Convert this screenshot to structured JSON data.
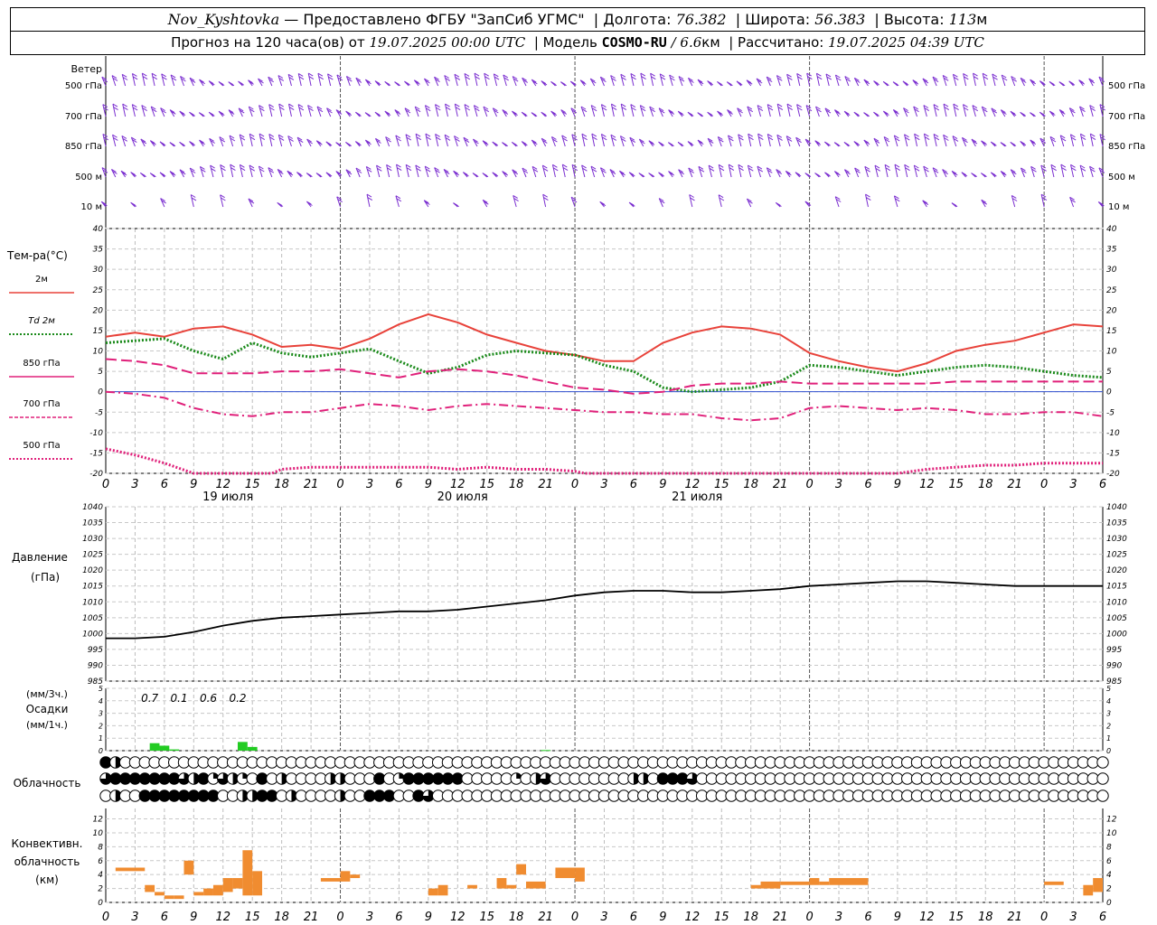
{
  "header": {
    "station": "Nov_Kyshtovka",
    "provided_by": "— Предоставлено ФГБУ \"ЗапСиб УГМС\"",
    "lon_label": "Долгота:",
    "lon_value": "76.382",
    "lat_label": "Широта:",
    "lat_value": "56.383",
    "alt_label": "Высота:",
    "alt_value": "113",
    "alt_unit": "м",
    "forecast_label": "Прогноз на 120 часа(ов) от",
    "forecast_start": "19.07.2025 00:00 UTC",
    "model_label": "Модель",
    "model_name": "COSMO-RU",
    "model_res": "/ 6.6",
    "model_res_unit": "км",
    "calc_label": "Рассчитано:",
    "calc_time": "19.07.2025 04:39 UTC"
  },
  "wind_panel": {
    "title": "Ветер",
    "levels": [
      "500 гПа",
      "700 гПа",
      "850 гПа",
      "500 м",
      "10 м"
    ],
    "color": "#7b2fd0"
  },
  "temp_panel": {
    "title": "Тем-ра(°С)",
    "series_labels": [
      "2м",
      "Td  2м",
      "850 гПа",
      "700 гПа",
      "500 гПа"
    ]
  },
  "pressure_panel": {
    "title": "Давление",
    "unit": "(гПа)"
  },
  "precip_panel": {
    "unit_top": "(мм/3ч.)",
    "title": "Осадки",
    "unit_bottom": "(мм/1ч.)",
    "totals": [
      {
        "hour": 4.5,
        "text": "0.7"
      },
      {
        "hour": 7.5,
        "text": "0.1"
      },
      {
        "hour": 10.5,
        "text": "0.6"
      },
      {
        "hour": 13.5,
        "text": "0.2"
      }
    ]
  },
  "cloud_panel": {
    "title": "Облачность"
  },
  "conv_panel": {
    "title_lines": [
      "Конвективн.",
      "облачность",
      "(км)"
    ]
  },
  "axis": {
    "hour_labels": [
      "0",
      "3",
      "6",
      "9",
      "12",
      "15",
      "18",
      "21"
    ],
    "day_labels": [
      "19 июля",
      "20 июля",
      "21 июля"
    ]
  },
  "chart_data": [
    {
      "type": "line",
      "title": "Тем-ра(°С)",
      "x_unit": "hours since 19.07.2025 00 UTC",
      "ylim": [
        -20,
        40
      ],
      "yticks": [
        -20,
        -15,
        -10,
        -5,
        0,
        5,
        10,
        15,
        20,
        25,
        30,
        35,
        40
      ],
      "series": [
        {
          "name": "2м",
          "color": "#e8423a",
          "style": "solid",
          "x": [
            0,
            3,
            6,
            9,
            12,
            15,
            18,
            21,
            24,
            27,
            30,
            33,
            36,
            39,
            42,
            45,
            48,
            51,
            54,
            57,
            60,
            63,
            66,
            69,
            72,
            75,
            78,
            81,
            84,
            87,
            90,
            93,
            96,
            99,
            102
          ],
          "y": [
            13.5,
            14.5,
            13.5,
            15.5,
            16,
            14,
            11,
            11.5,
            10.5,
            13,
            16.5,
            19,
            17,
            14,
            12,
            10,
            9,
            7.5,
            7.5,
            12,
            14.5,
            16,
            15.5,
            14,
            9.5,
            7.5,
            6,
            5,
            7,
            10,
            11.5,
            12.5,
            14.5,
            16.5,
            16
          ]
        },
        {
          "name": "Td  2м",
          "color": "#1a8a1a",
          "style": "dotted",
          "x": [
            0,
            3,
            6,
            9,
            12,
            15,
            18,
            21,
            24,
            27,
            30,
            33,
            36,
            39,
            42,
            45,
            48,
            51,
            54,
            57,
            60,
            63,
            66,
            69,
            72,
            75,
            78,
            81,
            84,
            87,
            90,
            93,
            96,
            99,
            102
          ],
          "y": [
            12,
            12.5,
            13,
            10,
            8,
            12,
            9.5,
            8.5,
            9.5,
            10.5,
            7.5,
            4.5,
            6,
            9,
            10,
            9.5,
            9,
            6.5,
            5,
            1,
            0,
            0.5,
            1,
            2.5,
            6.5,
            6,
            5,
            4,
            5,
            6,
            6.5,
            6,
            5,
            4,
            3.5
          ]
        },
        {
          "name": "850 гПа",
          "color": "#e0207a",
          "style": "long-dash",
          "x": [
            0,
            3,
            6,
            9,
            12,
            15,
            18,
            21,
            24,
            27,
            30,
            33,
            36,
            39,
            42,
            45,
            48,
            51,
            54,
            57,
            60,
            63,
            66,
            69,
            72,
            75,
            78,
            81,
            84,
            87,
            90,
            93,
            96,
            99,
            102
          ],
          "y": [
            8,
            7.5,
            6.5,
            4.5,
            4.5,
            4.5,
            5,
            5,
            5.5,
            4.5,
            3.5,
            5,
            5.5,
            5,
            4,
            2.5,
            1,
            0.5,
            -0.5,
            0,
            1.5,
            2,
            2,
            2.5,
            2,
            2,
            2,
            2,
            2,
            2.5,
            2.5,
            2.5,
            2.5,
            2.5,
            2.5
          ]
        },
        {
          "name": "700 гПа",
          "color": "#e0207a",
          "style": "dash-dot",
          "x": [
            0,
            3,
            6,
            9,
            12,
            15,
            18,
            21,
            24,
            27,
            30,
            33,
            36,
            39,
            42,
            45,
            48,
            51,
            54,
            57,
            60,
            63,
            66,
            69,
            72,
            75,
            78,
            81,
            84,
            87,
            90,
            93,
            96,
            99,
            102
          ],
          "y": [
            0,
            -0.5,
            -1.5,
            -4,
            -5.5,
            -6,
            -5,
            -5,
            -4,
            -3,
            -3.5,
            -4.5,
            -3.5,
            -3,
            -3.5,
            -4,
            -4.5,
            -5,
            -5,
            -5.5,
            -5.5,
            -6.5,
            -7,
            -6.5,
            -4,
            -3.5,
            -4,
            -4.5,
            -4,
            -4.5,
            -5.5,
            -5.5,
            -5,
            -5,
            -6
          ]
        },
        {
          "name": "500 гПа",
          "color": "#e0207a",
          "style": "dotted",
          "x": [
            0,
            3,
            6,
            9,
            10,
            11,
            12,
            13,
            14,
            15,
            16,
            17,
            18,
            21,
            24,
            27,
            30,
            33,
            36,
            39,
            42,
            45,
            48,
            49,
            50,
            51,
            80,
            81,
            84,
            87,
            90,
            93,
            96,
            99,
            102
          ],
          "y": [
            -14,
            -15.5,
            -17.5,
            -20,
            -21,
            -22,
            -23,
            -23,
            -22.5,
            -22,
            -21,
            -20,
            -19,
            -18.5,
            -18.5,
            -18.5,
            -18.5,
            -18.5,
            -19,
            -18.5,
            -19,
            -19,
            -19.5,
            -20,
            -21,
            -22,
            -21,
            -20,
            -19,
            -18.5,
            -18,
            -18,
            -17.5,
            -17.5,
            -17.5
          ]
        }
      ]
    },
    {
      "type": "line",
      "title": "Давление",
      "ylabel": "(гПа)",
      "x_unit": "hours since 19.07.2025 00 UTC",
      "ylim": [
        985,
        1040
      ],
      "yticks": [
        985,
        990,
        995,
        1000,
        1005,
        1010,
        1015,
        1020,
        1025,
        1030,
        1035,
        1040
      ],
      "series": [
        {
          "name": "",
          "color": "#000000",
          "x": [
            0,
            3,
            6,
            9,
            12,
            15,
            18,
            21,
            24,
            27,
            30,
            33,
            36,
            39,
            42,
            45,
            48,
            51,
            54,
            57,
            60,
            63,
            66,
            69,
            72,
            75,
            78,
            81,
            84,
            87,
            90,
            93,
            96,
            99,
            102
          ],
          "y": [
            998.5,
            998.5,
            999,
            1000.5,
            1002.5,
            1004,
            1005,
            1005.5,
            1006,
            1006.5,
            1007,
            1007,
            1007.5,
            1008.5,
            1009.5,
            1010.5,
            1012,
            1013,
            1013.5,
            1013.5,
            1013,
            1013,
            1013.5,
            1014,
            1015,
            1015.5,
            1016,
            1016.5,
            1016.5,
            1016,
            1015.5,
            1015,
            1015,
            1015,
            1015
          ]
        }
      ]
    },
    {
      "type": "bar",
      "title": "Осадки",
      "x_unit": "hours since 19.07.2025 00 UTC",
      "ylim": [
        0,
        5
      ],
      "yticks": [
        0,
        1,
        2,
        3,
        4,
        5
      ],
      "bars": [
        {
          "x": 5,
          "value": 0.6,
          "color": "#22cc22"
        },
        {
          "x": 6,
          "value": 0.4,
          "color": "#22cc22"
        },
        {
          "x": 7,
          "value": 0.1,
          "color": "#22cc22"
        },
        {
          "x": 14,
          "value": 0.7,
          "color": "#22cc22"
        },
        {
          "x": 15,
          "value": 0.3,
          "color": "#22cc22"
        },
        {
          "x": 45,
          "value": 0.05,
          "color": "#22cc22"
        }
      ]
    },
    {
      "type": "table",
      "title": "Облачность",
      "encoding": "cloud cover in octas per hour: 0 empty ... 8 full",
      "rows": [
        [
          8,
          4,
          0,
          0,
          0,
          0,
          0,
          0,
          0,
          0,
          0,
          0,
          0,
          0,
          0,
          0,
          0,
          0,
          0,
          0,
          0,
          0,
          0,
          0,
          0,
          0,
          0,
          0,
          0,
          0,
          0,
          0,
          0,
          0,
          0,
          0,
          0,
          0,
          0,
          0,
          0,
          0,
          0,
          0,
          0,
          0,
          0,
          0,
          0,
          0,
          0,
          0,
          0,
          0,
          0,
          0,
          0,
          0,
          0,
          0,
          0,
          0,
          0,
          0,
          0,
          0,
          0,
          0,
          0,
          0,
          0,
          0,
          0,
          0,
          0,
          0,
          0,
          0,
          0,
          0,
          0,
          0,
          0,
          0,
          0,
          0,
          0,
          0,
          0,
          0,
          0,
          0,
          0,
          0,
          0,
          0,
          0,
          0,
          0,
          0,
          0,
          0,
          0
        ],
        [
          6,
          8,
          8,
          8,
          8,
          8,
          8,
          8,
          6,
          4,
          8,
          2,
          6,
          4,
          2,
          0,
          8,
          0,
          4,
          0,
          0,
          0,
          0,
          4,
          4,
          0,
          0,
          0,
          8,
          0,
          2,
          8,
          8,
          8,
          8,
          8,
          8,
          0,
          0,
          0,
          0,
          0,
          2,
          0,
          4,
          6,
          0,
          0,
          0,
          0,
          0,
          0,
          0,
          0,
          4,
          4,
          0,
          8,
          8,
          8,
          6,
          0,
          0,
          0,
          0,
          0,
          0,
          0,
          0,
          0,
          0,
          0,
          0,
          0,
          0,
          0,
          0,
          0,
          0,
          0,
          0,
          0,
          0,
          0,
          0,
          0,
          0,
          0,
          0,
          0,
          0,
          0,
          0,
          0,
          0,
          0,
          0,
          0,
          0,
          0,
          0,
          0,
          0
        ],
        [
          0,
          4,
          0,
          0,
          8,
          8,
          8,
          8,
          8,
          8,
          8,
          8,
          0,
          0,
          4,
          4,
          8,
          8,
          0,
          4,
          0,
          0,
          0,
          0,
          4,
          0,
          0,
          8,
          8,
          8,
          0,
          0,
          8,
          6,
          0,
          0,
          0,
          0,
          0,
          0,
          0,
          0,
          0,
          0,
          0,
          0,
          0,
          0,
          0,
          0,
          0,
          0,
          0,
          0,
          0,
          0,
          0,
          0,
          0,
          0,
          0,
          0,
          0,
          0,
          0,
          0,
          0,
          0,
          0,
          0,
          0,
          0,
          0,
          0,
          0,
          0,
          0,
          0,
          0,
          0,
          0,
          0,
          0,
          0,
          0,
          0,
          0,
          0,
          0,
          0,
          0,
          0,
          0,
          0,
          0,
          0,
          0,
          0,
          0,
          0,
          0,
          0,
          0
        ]
      ]
    },
    {
      "type": "bar",
      "title": "Конвективн. облачность (км)",
      "x_unit": "hours since 19.07.2025 00 UTC",
      "ylim": [
        0,
        13
      ],
      "yticks": [
        0,
        2,
        4,
        6,
        8,
        10,
        12
      ],
      "color": "#f08c30",
      "bars": [
        {
          "x0": 1,
          "x1": 4,
          "bottom": 4.5,
          "top": 5
        },
        {
          "x0": 4,
          "x1": 5,
          "bottom": 1.5,
          "top": 2.5
        },
        {
          "x0": 5,
          "x1": 6,
          "bottom": 1,
          "top": 1.5
        },
        {
          "x0": 6,
          "x1": 7,
          "bottom": 0.5,
          "top": 1
        },
        {
          "x0": 7,
          "x1": 8,
          "bottom": 0.5,
          "top": 1
        },
        {
          "x0": 8,
          "x1": 9,
          "bottom": 4,
          "top": 6
        },
        {
          "x0": 9,
          "x1": 10,
          "bottom": 1,
          "top": 1.5
        },
        {
          "x0": 10,
          "x1": 11,
          "bottom": 1,
          "top": 2
        },
        {
          "x0": 11,
          "x1": 12,
          "bottom": 1,
          "top": 2.5
        },
        {
          "x0": 12,
          "x1": 13,
          "bottom": 1.5,
          "top": 3.5
        },
        {
          "x0": 13,
          "x1": 14,
          "bottom": 2,
          "top": 3.5
        },
        {
          "x0": 14,
          "x1": 15,
          "bottom": 1,
          "top": 7.5
        },
        {
          "x0": 15,
          "x1": 16,
          "bottom": 1,
          "top": 4.5
        },
        {
          "x0": 22,
          "x1": 24,
          "bottom": 3,
          "top": 3.5
        },
        {
          "x0": 24,
          "x1": 25,
          "bottom": 3,
          "top": 4.5
        },
        {
          "x0": 25,
          "x1": 26,
          "bottom": 3.5,
          "top": 4
        },
        {
          "x0": 33,
          "x1": 34,
          "bottom": 1,
          "top": 2
        },
        {
          "x0": 34,
          "x1": 35,
          "bottom": 1,
          "top": 2.5
        },
        {
          "x0": 37,
          "x1": 38,
          "bottom": 2,
          "top": 2.5
        },
        {
          "x0": 40,
          "x1": 41,
          "bottom": 2,
          "top": 3.5
        },
        {
          "x0": 41,
          "x1": 42,
          "bottom": 2,
          "top": 2.5
        },
        {
          "x0": 42,
          "x1": 43,
          "bottom": 4,
          "top": 5.5
        },
        {
          "x0": 43,
          "x1": 45,
          "bottom": 2,
          "top": 3
        },
        {
          "x0": 46,
          "x1": 48,
          "bottom": 3.5,
          "top": 5
        },
        {
          "x0": 48,
          "x1": 49,
          "bottom": 3,
          "top": 5
        },
        {
          "x0": 66,
          "x1": 67,
          "bottom": 2,
          "top": 2.5
        },
        {
          "x0": 67,
          "x1": 69,
          "bottom": 2,
          "top": 3
        },
        {
          "x0": 69,
          "x1": 72,
          "bottom": 2.5,
          "top": 3
        },
        {
          "x0": 72,
          "x1": 73,
          "bottom": 2.5,
          "top": 3.5
        },
        {
          "x0": 73,
          "x1": 74,
          "bottom": 2.5,
          "top": 3
        },
        {
          "x0": 74,
          "x1": 78,
          "bottom": 2.5,
          "top": 3.5
        },
        {
          "x0": 96,
          "x1": 98,
          "bottom": 2.5,
          "top": 3
        },
        {
          "x0": 100,
          "x1": 101,
          "bottom": 1,
          "top": 2.5
        },
        {
          "x0": 101,
          "x1": 102,
          "bottom": 1.5,
          "top": 3.5
        }
      ]
    }
  ]
}
